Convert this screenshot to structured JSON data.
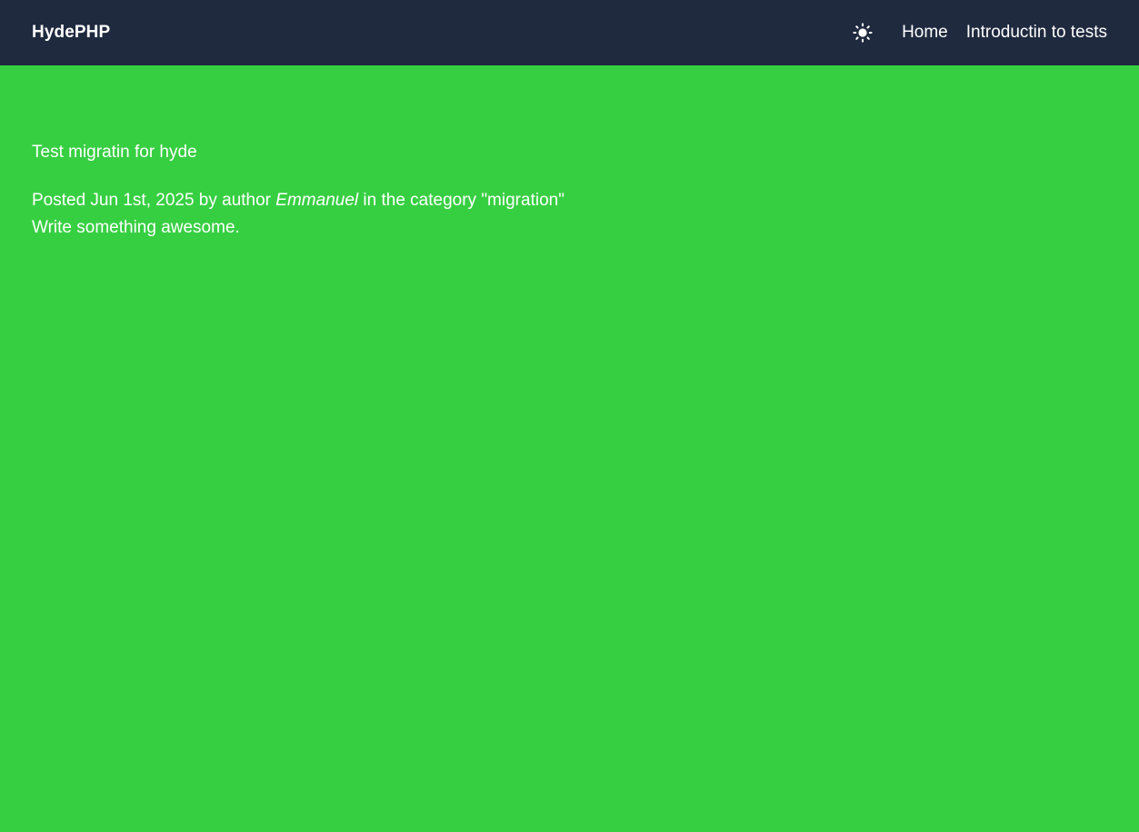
{
  "nav": {
    "brand": "HydePHP",
    "theme_icon": "sun-icon",
    "links": [
      {
        "label": "Home"
      },
      {
        "label": "Introductin to tests"
      }
    ]
  },
  "post": {
    "title": "Test migratin for hyde",
    "meta_prefix": "Posted Jun 1st, 2025 by author",
    "author": "Emmanuel",
    "meta_suffix": "in the category \"migration\"",
    "body": "Write something awesome."
  },
  "colors": {
    "navbar_bg": "#1f2a3f",
    "page_bg": "#37cf42",
    "text": "#ffffff"
  }
}
